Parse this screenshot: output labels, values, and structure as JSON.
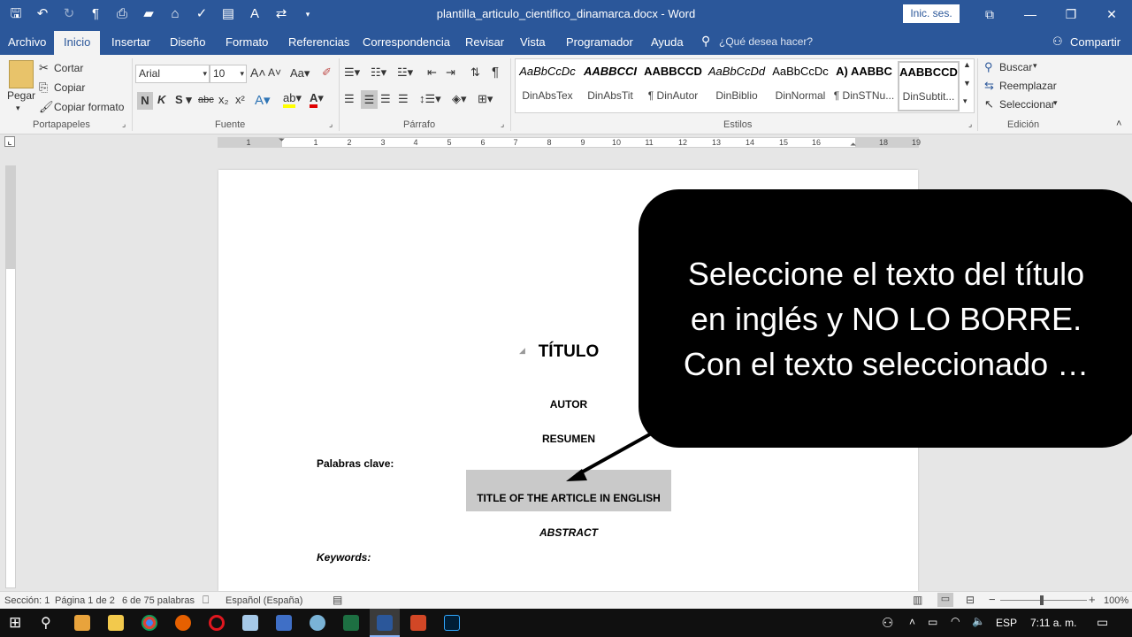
{
  "window": {
    "doc_title": "plantilla_articulo_cientifico_dinamarca.docx - Word",
    "signin": "Inic. ses."
  },
  "menu": {
    "tabs": [
      "Archivo",
      "Inicio",
      "Insertar",
      "Diseño",
      "Formato",
      "Referencias",
      "Correspondencia",
      "Revisar",
      "Vista",
      "Programador",
      "Ayuda"
    ],
    "tellme": "¿Qué desea hacer?",
    "share": "Compartir"
  },
  "ribbon": {
    "clipboard": {
      "paste": "Pegar",
      "cut": "Cortar",
      "copy": "Copiar",
      "format_painter": "Copiar formato",
      "label": "Portapapeles"
    },
    "font": {
      "name": "Arial",
      "size": "10",
      "label": "Fuente"
    },
    "paragraph": {
      "label": "Párrafo"
    },
    "styles": {
      "label": "Estilos",
      "items": [
        {
          "preview": "AaBbCcDc",
          "name": "DinAbsTex"
        },
        {
          "preview": "AABBCCI",
          "name": "DinAbsTit"
        },
        {
          "preview": "AABBCCD",
          "name": "¶ DinAutor"
        },
        {
          "preview": "AaBbCcDd",
          "name": "DinBiblio"
        },
        {
          "preview": "AaBbCcDc",
          "name": "DinNormal"
        },
        {
          "preview": "A) AABBC",
          "name": "¶ DinSTNu..."
        },
        {
          "preview": "AABBCCD",
          "name": "DinSubtit..."
        }
      ]
    },
    "editing": {
      "label": "Edición",
      "find": "Buscar",
      "replace": "Reemplazar",
      "select": "Seleccionar"
    }
  },
  "ruler": {
    "marks": [
      "1",
      "1",
      "2",
      "3",
      "4",
      "5",
      "6",
      "7",
      "8",
      "9",
      "10",
      "11",
      "12",
      "13",
      "14",
      "15",
      "16",
      "18",
      "19"
    ]
  },
  "document": {
    "title": "TÍTULO",
    "author": "AUTOR",
    "resumen": "RESUMEN",
    "keywords_es": "Palabras clave:",
    "title_en": "TITLE OF THE ARTICLE IN ENGLISH",
    "abstract": "ABSTRACT",
    "keywords_en": "Keywords:"
  },
  "callout": {
    "line1": "Seleccione el texto del título",
    "line2": "en inglés y NO LO BORRE.",
    "line3": "Con el texto seleccionado …"
  },
  "status": {
    "section": "Sección: 1",
    "page": "Página 1 de 2",
    "words": "6 de 75 palabras",
    "language": "Español (España)",
    "zoom": "100%"
  },
  "taskbar": {
    "lang": "ESP",
    "time": "7:11 a. m."
  }
}
